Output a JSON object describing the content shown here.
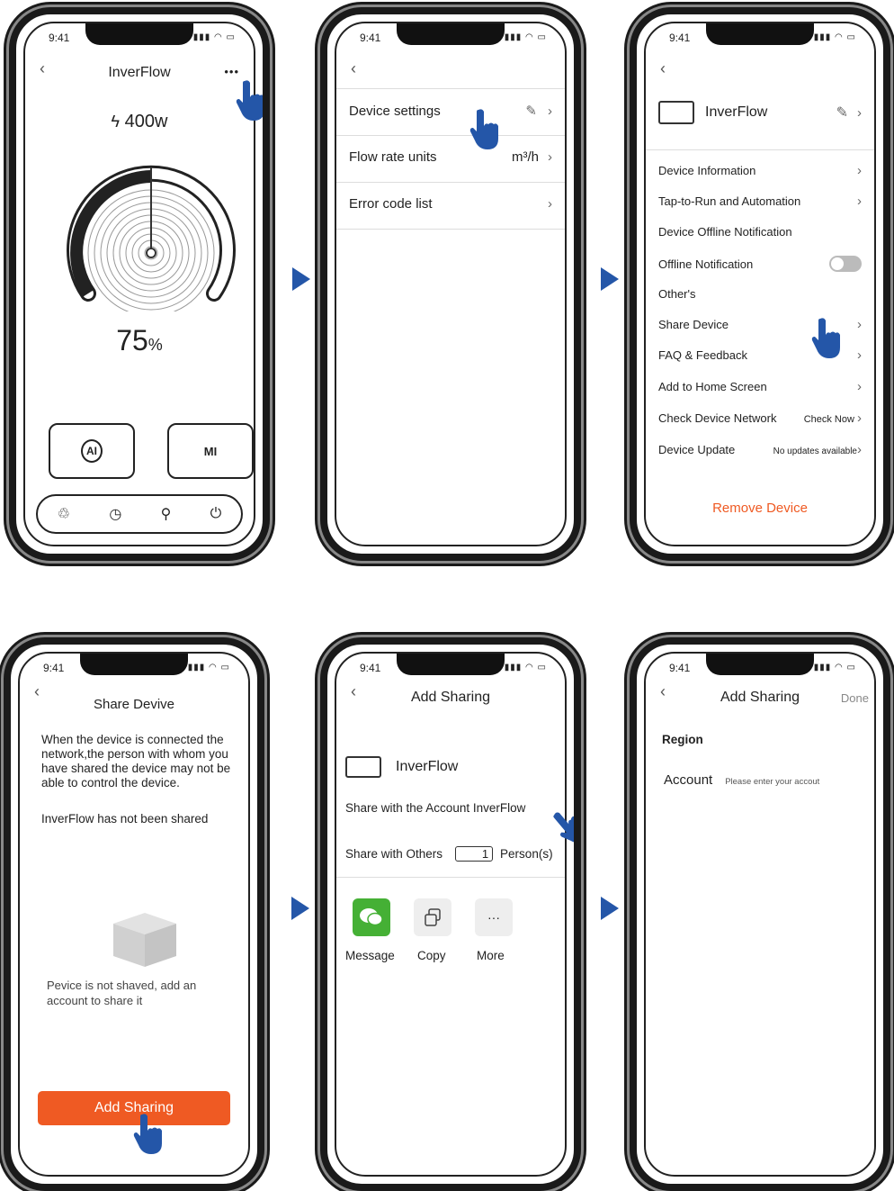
{
  "status": {
    "time": "9:41",
    "icons": "▮▮▮ ◠ ▭"
  },
  "hand_color": "#2456a8",
  "accent": "#ef5a23",
  "p1": {
    "title": "InverFlow",
    "power": "400w",
    "power_icon": "ϟ",
    "more": "•••",
    "percent": "75",
    "percent_sign": "%",
    "btn_ai": "AI",
    "btn_mi": "MI",
    "gauge_level": 0.75,
    "nav": [
      "♲",
      "◷",
      "⚲",
      "⏻"
    ]
  },
  "p2": {
    "rows": [
      {
        "label": "Device settings",
        "value": "",
        "icon": "✎"
      },
      {
        "label": "Flow rate units",
        "value": "m³/h",
        "icon": ""
      },
      {
        "label": "Error code list",
        "value": "",
        "icon": ""
      }
    ]
  },
  "p3": {
    "title": "InverFlow",
    "items": [
      {
        "label": "Device Information",
        "value": ""
      },
      {
        "label": "Tap-to-Run and Automation",
        "value": ""
      },
      {
        "label": "Device Offline Notification",
        "value": ""
      },
      {
        "label": "Offline Notification",
        "value": ""
      },
      {
        "label": "Other's",
        "value": ""
      },
      {
        "label": "Share Device",
        "value": ""
      },
      {
        "label": "FAQ & Feedback",
        "value": ""
      },
      {
        "label": "Add to Home Screen",
        "value": ""
      },
      {
        "label": "Check Device Network",
        "value": "Check Now"
      },
      {
        "label": "Device Update",
        "value": "No updates available"
      }
    ],
    "remove": "Remove Device"
  },
  "p4": {
    "title": "Share Devive",
    "desc": "When the device is connected the network,the person with whom you have shared the device may not be able to control the device.",
    "status": "InverFlow has not been shared",
    "empty": "Pevice is  not  shaved, add an account to share it",
    "button": "Add Sharing"
  },
  "p5": {
    "title": "Add Sharing",
    "device": "InverFlow",
    "share_account": "Share with the Account InverFlow",
    "share_others": "Share with Others",
    "count": "1",
    "persons": "Person(s)",
    "tiles": [
      "Message",
      "Copy",
      "More"
    ],
    "more_glyph": "···"
  },
  "p6": {
    "title": "Add Sharing",
    "done": "Done",
    "region": "Region",
    "account": "Account",
    "placeholder": "Please enter your accout"
  }
}
